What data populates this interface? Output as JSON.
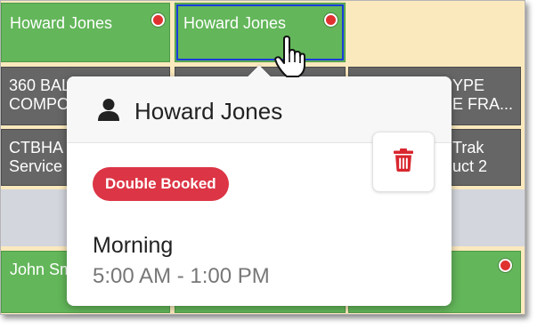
{
  "schedule": {
    "row1": {
      "cell1_name": "Howard Jones",
      "cell2_name": "Howard Jones"
    },
    "row2": {
      "cell1_text": "360 BAL\nCOMPO",
      "cell3_text": "YPE\nE FRA..."
    },
    "row3": {
      "cell1_text": "CTBHA\nService",
      "cell3_text": "Trak\nuct 2"
    },
    "row5": {
      "cell1_name": "John Sm"
    }
  },
  "popover": {
    "title": "Howard Jones",
    "title_icon": "user-icon",
    "delete_icon": "trash-icon",
    "badge": "Double Booked",
    "shift_name": "Morning",
    "shift_time": "5:00 AM - 1:00 PM"
  },
  "colors": {
    "shift_green": "#63b65a",
    "shift_gray": "#666666",
    "empty_cream": "#fbe9be",
    "conflict_red": "#e03131",
    "badge_red": "#dc3545",
    "delete_icon_red": "#d9262e"
  }
}
